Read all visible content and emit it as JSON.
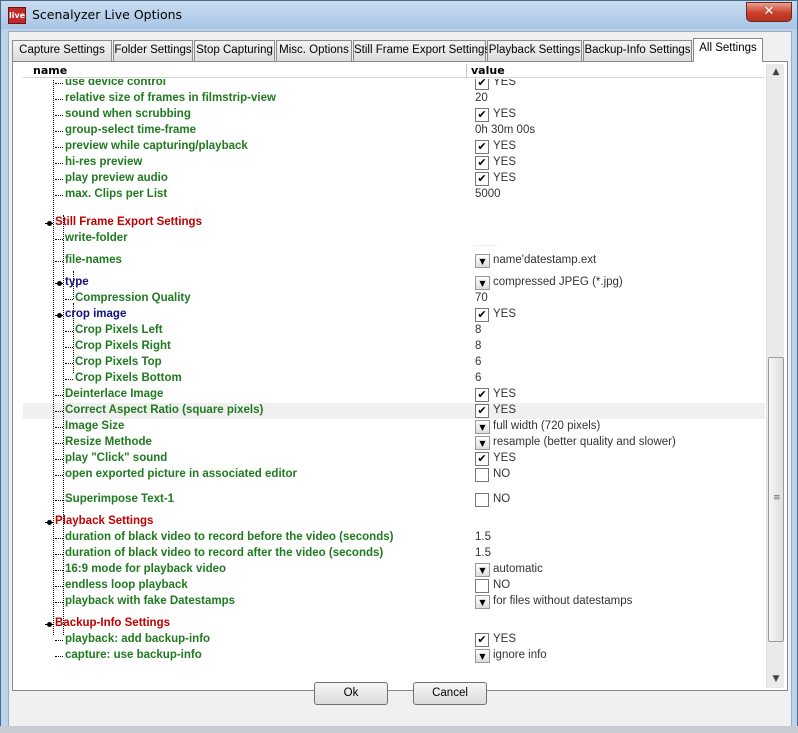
{
  "window": {
    "title": "Scenalyzer Live Options",
    "close_glyph": "✕",
    "icon": "app-icon",
    "icon_label": "live"
  },
  "tabs": [
    {
      "label": "Capture Settings",
      "active": false
    },
    {
      "label": "Folder Settings",
      "active": false
    },
    {
      "label": "Stop Capturing",
      "active": false
    },
    {
      "label": "Misc. Options",
      "active": false
    },
    {
      "label": "Still Frame Export Settings",
      "active": false
    },
    {
      "label": "Playback Settings",
      "active": false
    },
    {
      "label": "Backup-Info Settings",
      "active": false
    },
    {
      "label": "All Settings",
      "active": true
    }
  ],
  "columns": {
    "name": "name",
    "value": "value"
  },
  "colors": {
    "setting": "#207a20",
    "section": "#c00000",
    "subsection": "#101080"
  },
  "rows": [
    {
      "label": "use device control",
      "kind": "g",
      "control": "checkbox",
      "checked": true,
      "value": "YES"
    },
    {
      "label": "relative size of frames in filmstrip-view",
      "kind": "g",
      "control": "text",
      "value": "20"
    },
    {
      "label": "sound when scrubbing",
      "kind": "g",
      "control": "checkbox",
      "checked": true,
      "value": "YES"
    },
    {
      "label": "group-select time-frame",
      "kind": "g",
      "control": "text",
      "value": "0h 30m 00s"
    },
    {
      "label": "preview while capturing/playback",
      "kind": "g",
      "control": "checkbox",
      "checked": true,
      "value": "YES"
    },
    {
      "label": "hi-res preview",
      "kind": "g",
      "control": "checkbox",
      "checked": true,
      "value": "YES"
    },
    {
      "label": "play preview audio",
      "kind": "g",
      "control": "checkbox",
      "checked": true,
      "value": "YES"
    },
    {
      "label": "max. Clips per List",
      "kind": "g",
      "control": "text",
      "value": "5000"
    },
    {
      "label": "Still Frame Export Settings",
      "kind": "r",
      "control": "none",
      "value": ""
    },
    {
      "label": "write-folder",
      "kind": "g",
      "control": "box",
      "value": ""
    },
    {
      "label": "file-names",
      "kind": "g",
      "control": "dropdown",
      "value": "name'datestamp.ext"
    },
    {
      "label": "type",
      "kind": "b",
      "control": "dropdown",
      "value": "compressed JPEG (*.jpg)"
    },
    {
      "label": "Compression Quality",
      "kind": "g",
      "control": "text",
      "value": "70"
    },
    {
      "label": "crop image",
      "kind": "b",
      "control": "checkbox",
      "checked": true,
      "value": "YES"
    },
    {
      "label": "Crop Pixels Left",
      "kind": "g",
      "control": "text",
      "value": "8"
    },
    {
      "label": "Crop Pixels Right",
      "kind": "g",
      "control": "text",
      "value": "8"
    },
    {
      "label": "Crop Pixels Top",
      "kind": "g",
      "control": "text",
      "value": "6"
    },
    {
      "label": "Crop Pixels Bottom",
      "kind": "g",
      "control": "text",
      "value": "6"
    },
    {
      "label": "Deinterlace Image",
      "kind": "g",
      "control": "checkbox",
      "checked": true,
      "value": "YES"
    },
    {
      "label": "Correct Aspect Ratio (square pixels)",
      "kind": "g",
      "control": "checkbox",
      "checked": true,
      "value": "YES"
    },
    {
      "label": "Image Size",
      "kind": "g",
      "control": "dropdown",
      "value": "full width (720 pixels)"
    },
    {
      "label": "Resize Methode",
      "kind": "g",
      "control": "dropdown",
      "value": "resample (better quality and slower)"
    },
    {
      "label": "play \"Click\" sound",
      "kind": "g",
      "control": "checkbox",
      "checked": true,
      "value": "YES"
    },
    {
      "label": "open exported picture in associated editor",
      "kind": "g",
      "control": "checkbox",
      "checked": false,
      "value": "NO"
    },
    {
      "label": "Superimpose Text-1",
      "kind": "g",
      "control": "checkbox",
      "checked": false,
      "value": "NO"
    },
    {
      "label": "Playback Settings",
      "kind": "r",
      "control": "none",
      "value": ""
    },
    {
      "label": "duration of black video to record before the video (seconds)",
      "kind": "g",
      "control": "text",
      "value": "1.5"
    },
    {
      "label": "duration of black video to record after the video (seconds)",
      "kind": "g",
      "control": "text",
      "value": "1.5"
    },
    {
      "label": "16:9 mode for playback video",
      "kind": "g",
      "control": "dropdown",
      "value": "automatic"
    },
    {
      "label": "endless loop playback",
      "kind": "g",
      "control": "checkbox",
      "checked": false,
      "value": "NO"
    },
    {
      "label": "playback with fake Datestamps",
      "kind": "g",
      "control": "dropdown",
      "value": "for files without datestamps"
    },
    {
      "label": "Backup-Info Settings",
      "kind": "r",
      "control": "none",
      "value": ""
    },
    {
      "label": "playback: add backup-info",
      "kind": "g",
      "control": "checkbox",
      "checked": true,
      "value": "YES"
    },
    {
      "label": "capture: use backup-info",
      "kind": "g",
      "control": "dropdown",
      "value": "ignore info"
    }
  ],
  "scroll": {
    "up_glyph": "▲",
    "down_glyph": "▼",
    "grip_glyph": "≡"
  },
  "buttons": {
    "ok": "Ok",
    "cancel": "Cancel"
  }
}
